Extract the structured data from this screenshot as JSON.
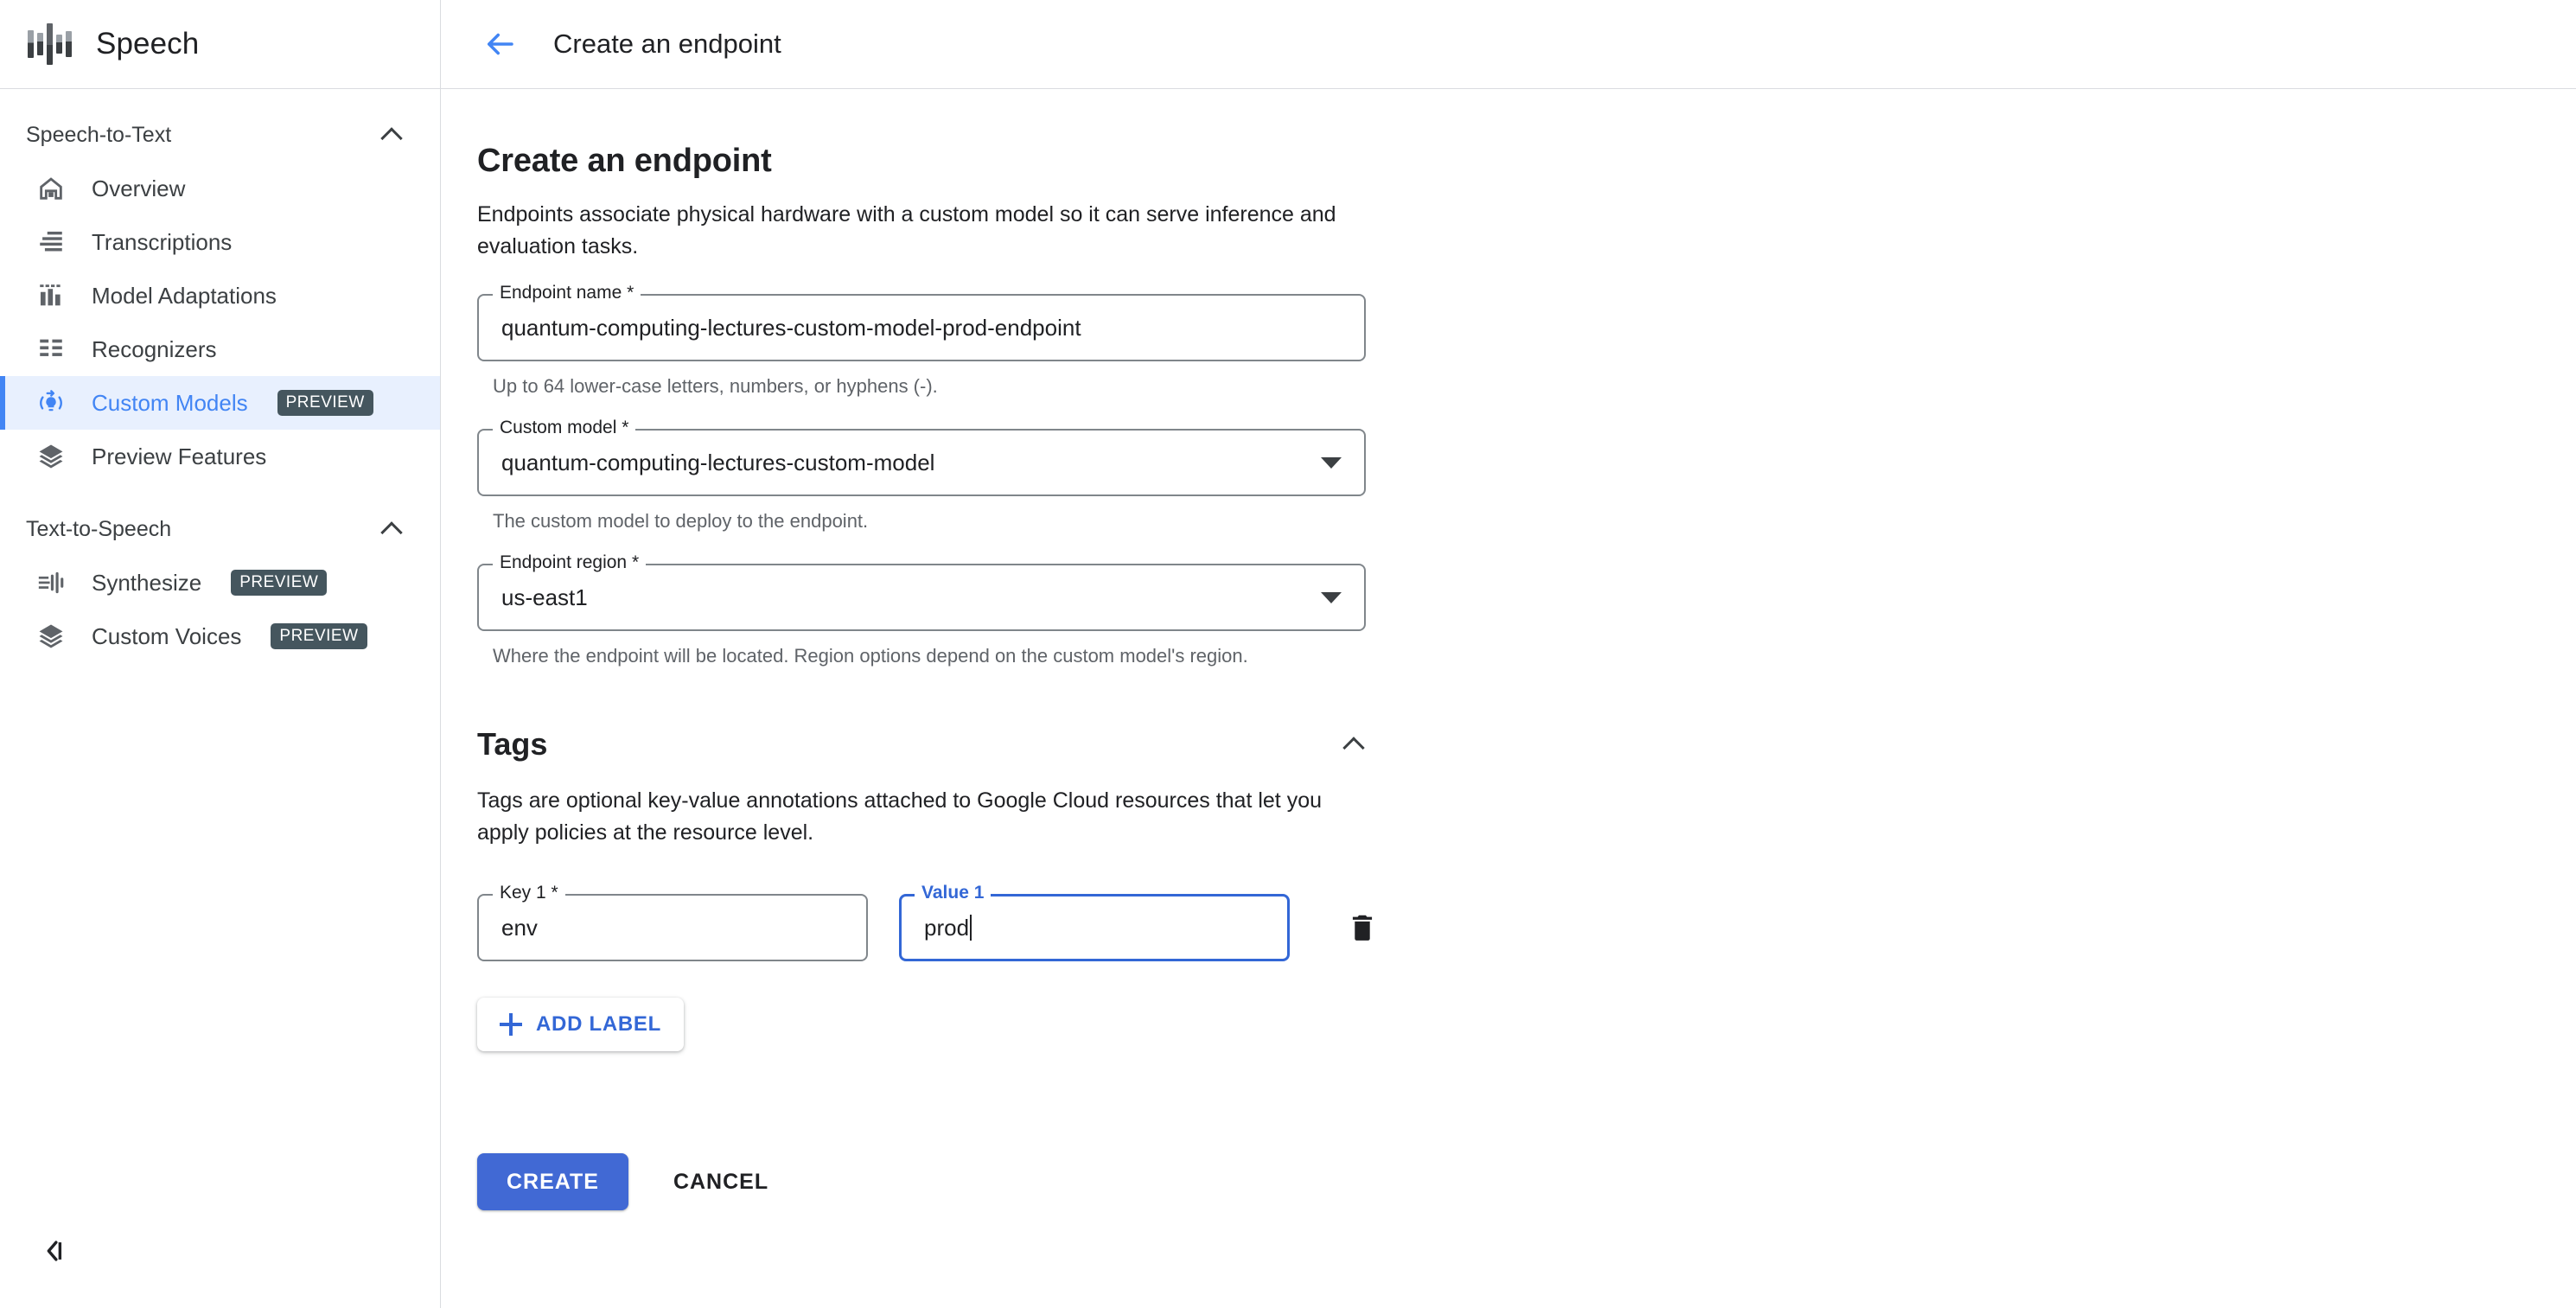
{
  "brand": {
    "title": "Speech",
    "logo_icon": "speech-waveform-logo"
  },
  "sidebar": {
    "groups": [
      {
        "label": "Speech-to-Text",
        "collapse_icon": "chevron-up-icon",
        "items": [
          {
            "label": "Overview",
            "icon": "home-icon",
            "badge": "",
            "active": false
          },
          {
            "label": "Transcriptions",
            "icon": "transcription-lines-icon",
            "badge": "",
            "active": false
          },
          {
            "label": "Model Adaptations",
            "icon": "bar-chart-icon",
            "badge": "",
            "active": false
          },
          {
            "label": "Recognizers",
            "icon": "list-grid-icon",
            "badge": "",
            "active": false
          },
          {
            "label": "Custom Models",
            "icon": "model-tuning-icon",
            "badge": "PREVIEW",
            "active": true
          },
          {
            "label": "Preview Features",
            "icon": "layers-icon",
            "badge": "",
            "active": false
          }
        ]
      },
      {
        "label": "Text-to-Speech",
        "collapse_icon": "chevron-up-icon",
        "items": [
          {
            "label": "Synthesize",
            "icon": "synthesize-waveform-icon",
            "badge": "PREVIEW",
            "active": false
          },
          {
            "label": "Custom Voices",
            "icon": "layers-icon",
            "badge": "PREVIEW",
            "active": false
          }
        ]
      }
    ],
    "collapse_panel_icon": "collapse-panel-icon"
  },
  "topbar": {
    "back_icon": "back-arrow-icon",
    "title": "Create an endpoint"
  },
  "page": {
    "heading": "Create an endpoint",
    "description": "Endpoints associate physical hardware with a custom model so it can serve inference and evaluation tasks."
  },
  "form": {
    "endpoint_name": {
      "label": "Endpoint name *",
      "value": "quantum-computing-lectures-custom-model-prod-endpoint",
      "helper": "Up to 64 lower-case letters, numbers, or hyphens (-)."
    },
    "custom_model": {
      "label": "Custom model *",
      "value": "quantum-computing-lectures-custom-model",
      "helper": "The custom model to deploy to the endpoint.",
      "dropdown_icon": "chevron-down-icon"
    },
    "endpoint_region": {
      "label": "Endpoint region *",
      "value": "us-east1",
      "helper": "Where the endpoint will be located. Region options depend on the custom model's region.",
      "dropdown_icon": "chevron-down-icon"
    }
  },
  "tags": {
    "title": "Tags",
    "collapse_icon": "chevron-up-icon",
    "description": "Tags are optional key-value annotations attached to Google Cloud resources that let you apply policies at the resource level.",
    "rows": [
      {
        "key_label": "Key 1 *",
        "key_value": "env",
        "value_label": "Value 1",
        "value_value": "prod",
        "value_focused": true,
        "delete_icon": "trash-icon"
      }
    ],
    "add_label_button": "ADD LABEL",
    "add_icon": "plus-icon"
  },
  "actions": {
    "create": "CREATE",
    "cancel": "CANCEL"
  },
  "colors": {
    "accent_blue": "#4285f4",
    "focus_blue": "#3367d6",
    "create_button": "#4169d4",
    "badge_bg": "#45565e",
    "active_item_bg": "#e8f0fe",
    "border_grey": "#dadce0",
    "helper_text": "#5f6368",
    "text_primary": "#202124"
  }
}
